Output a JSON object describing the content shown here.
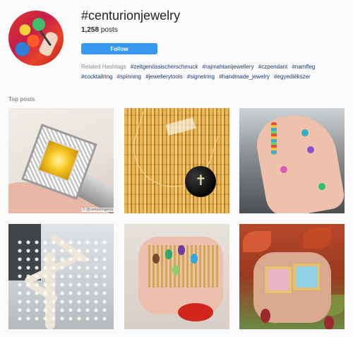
{
  "profile": {
    "hashtag": "#centurionjewelry",
    "posts_count": "1,258",
    "posts_label": "posts",
    "follow_label": "Follow",
    "avatar_icon": "hashtag-avatar-image"
  },
  "related": {
    "label": "Related Hashtags",
    "tags": [
      "#zeitgenössischerschmuck",
      "#rajmahtanijewellery",
      "#czpendant",
      "#namfleg",
      "#cocktailring",
      "#spinning",
      "#jewellerytools",
      "#signetring",
      "#handmade_jewelry",
      "#egyediékszer"
    ]
  },
  "top_posts": {
    "label": "Top posts",
    "tiles": [
      {
        "alt": "yellow stone halo ring",
        "watermark": "© @centuriongems"
      },
      {
        "alt": "black pendant on gold"
      },
      {
        "alt": "hand with colorful rings"
      },
      {
        "alt": "coral with pearls"
      },
      {
        "alt": "stacked gemstone rings"
      },
      {
        "alt": "square gemstone rings"
      }
    ]
  },
  "colors": {
    "follow_button": "#3897f0",
    "hashtag_link": "#1b3a72",
    "muted_text": "#8e8e8e"
  }
}
